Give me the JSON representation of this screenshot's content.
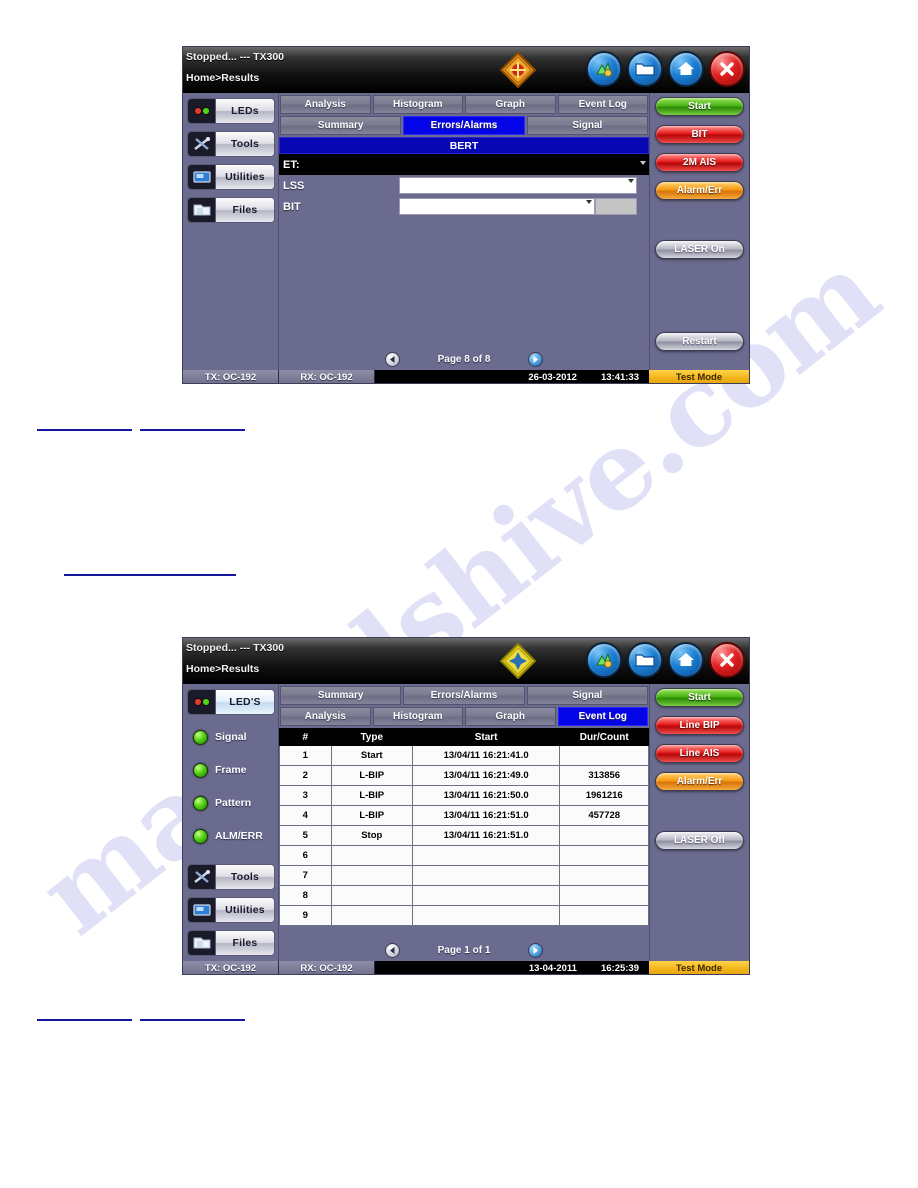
{
  "watermark": "manualshive.com",
  "screens": [
    {
      "id": "screen-bert",
      "status": "Stopped... --- TX300",
      "breadcrumb": "Home>Results",
      "diamond_color": "#e2801a",
      "titlebar_icons": [
        "signal-icon",
        "folder-icon",
        "home-icon",
        "close-icon"
      ],
      "left_rail": {
        "type": "buttons",
        "items": [
          {
            "label": "LEDs",
            "icon": "leds-icon",
            "selected": false
          },
          {
            "label": "Tools",
            "icon": "tools-icon",
            "selected": false
          },
          {
            "label": "Utilities",
            "icon": "utilities-icon",
            "selected": false
          },
          {
            "label": "Files",
            "icon": "files-icon",
            "selected": false
          }
        ]
      },
      "tabs_row1": [
        {
          "label": "Analysis",
          "active": false
        },
        {
          "label": "Histogram",
          "active": false
        },
        {
          "label": "Graph",
          "active": false
        },
        {
          "label": "Event Log",
          "active": false
        }
      ],
      "tabs_row2": [
        {
          "label": "Summary",
          "active": false
        },
        {
          "label": "Errors/Alarms",
          "active": true
        },
        {
          "label": "Signal",
          "active": false
        }
      ],
      "section_title": "BERT",
      "form_rows": [
        {
          "label": "ET:",
          "value": "",
          "style": "black"
        },
        {
          "label": "LSS",
          "value": "",
          "style": "field"
        },
        {
          "label": "BIT",
          "value": "",
          "style": "field-split"
        }
      ],
      "pager": {
        "prev": "prev-page-icon",
        "text": "Page 8 of 8",
        "next": "next-page-icon"
      },
      "right_rail": [
        {
          "label": "Start",
          "color": "green"
        },
        {
          "label": "BIT",
          "color": "red"
        },
        {
          "label": "2M AIS",
          "color": "red"
        },
        {
          "label": "Alarm/Err",
          "color": "orange"
        }
      ],
      "right_rail_laser": {
        "label": "LASER On",
        "color": "gray"
      },
      "right_rail_restart": {
        "label": "Restart",
        "color": "gray"
      },
      "statusbar": {
        "tx": "TX: OC-192",
        "rx": "RX: OC-192",
        "date": "26-03-2012",
        "time": "13:41:33",
        "mode": "Test Mode"
      }
    },
    {
      "id": "screen-eventlog",
      "status": "Stopped... --- TX300",
      "breadcrumb": "Home>Results",
      "diamond_color": "#e2d21a",
      "titlebar_icons": [
        "signal-icon",
        "folder-icon",
        "home-icon",
        "close-icon"
      ],
      "left_rail": {
        "type": "leds",
        "header": {
          "label": "LED'S",
          "icon": "leds-icon",
          "selected": true
        },
        "leds": [
          {
            "label": "Signal",
            "color": "#57d417"
          },
          {
            "label": "Frame",
            "color": "#57d417"
          },
          {
            "label": "Pattern",
            "color": "#57d417"
          },
          {
            "label": "ALM/ERR",
            "color": "#57d417"
          }
        ],
        "items": [
          {
            "label": "Tools",
            "icon": "tools-icon",
            "selected": false
          },
          {
            "label": "Utilities",
            "icon": "utilities-icon",
            "selected": false
          },
          {
            "label": "Files",
            "icon": "files-icon",
            "selected": false
          }
        ]
      },
      "tabs_row1": [
        {
          "label": "Summary",
          "active": false
        },
        {
          "label": "Errors/Alarms",
          "active": false
        },
        {
          "label": "Signal",
          "active": false
        }
      ],
      "tabs_row2": [
        {
          "label": "Analysis",
          "active": false
        },
        {
          "label": "Histogram",
          "active": false
        },
        {
          "label": "Graph",
          "active": false
        },
        {
          "label": "Event Log",
          "active": true
        }
      ],
      "table": {
        "headers": [
          "#",
          "Type",
          "Start",
          "Dur/Count"
        ],
        "rows": [
          [
            "1",
            "Start",
            "13/04/11 16:21:41.0",
            ""
          ],
          [
            "2",
            "L-BIP",
            "13/04/11 16:21:49.0",
            "313856"
          ],
          [
            "3",
            "L-BIP",
            "13/04/11 16:21:50.0",
            "1961216"
          ],
          [
            "4",
            "L-BIP",
            "13/04/11 16:21:51.0",
            "457728"
          ],
          [
            "5",
            "Stop",
            "13/04/11 16:21:51.0",
            ""
          ],
          [
            "6",
            "",
            "",
            ""
          ],
          [
            "7",
            "",
            "",
            ""
          ],
          [
            "8",
            "",
            "",
            ""
          ],
          [
            "9",
            "",
            "",
            ""
          ]
        ]
      },
      "pager": {
        "prev": "prev-page-icon",
        "text": "Page 1 of 1",
        "next": "next-page-icon"
      },
      "right_rail": [
        {
          "label": "Start",
          "color": "green"
        },
        {
          "label": "Line BIP",
          "color": "red"
        },
        {
          "label": "Line AIS",
          "color": "red"
        },
        {
          "label": "Alarm/Err",
          "color": "orange"
        }
      ],
      "right_rail_laser": {
        "label": "LASER Off",
        "color": "gray"
      },
      "statusbar": {
        "tx": "TX: OC-192",
        "rx": "RX: OC-192",
        "date": "13-04-2011",
        "time": "16:25:39",
        "mode": "Test Mode"
      }
    }
  ]
}
